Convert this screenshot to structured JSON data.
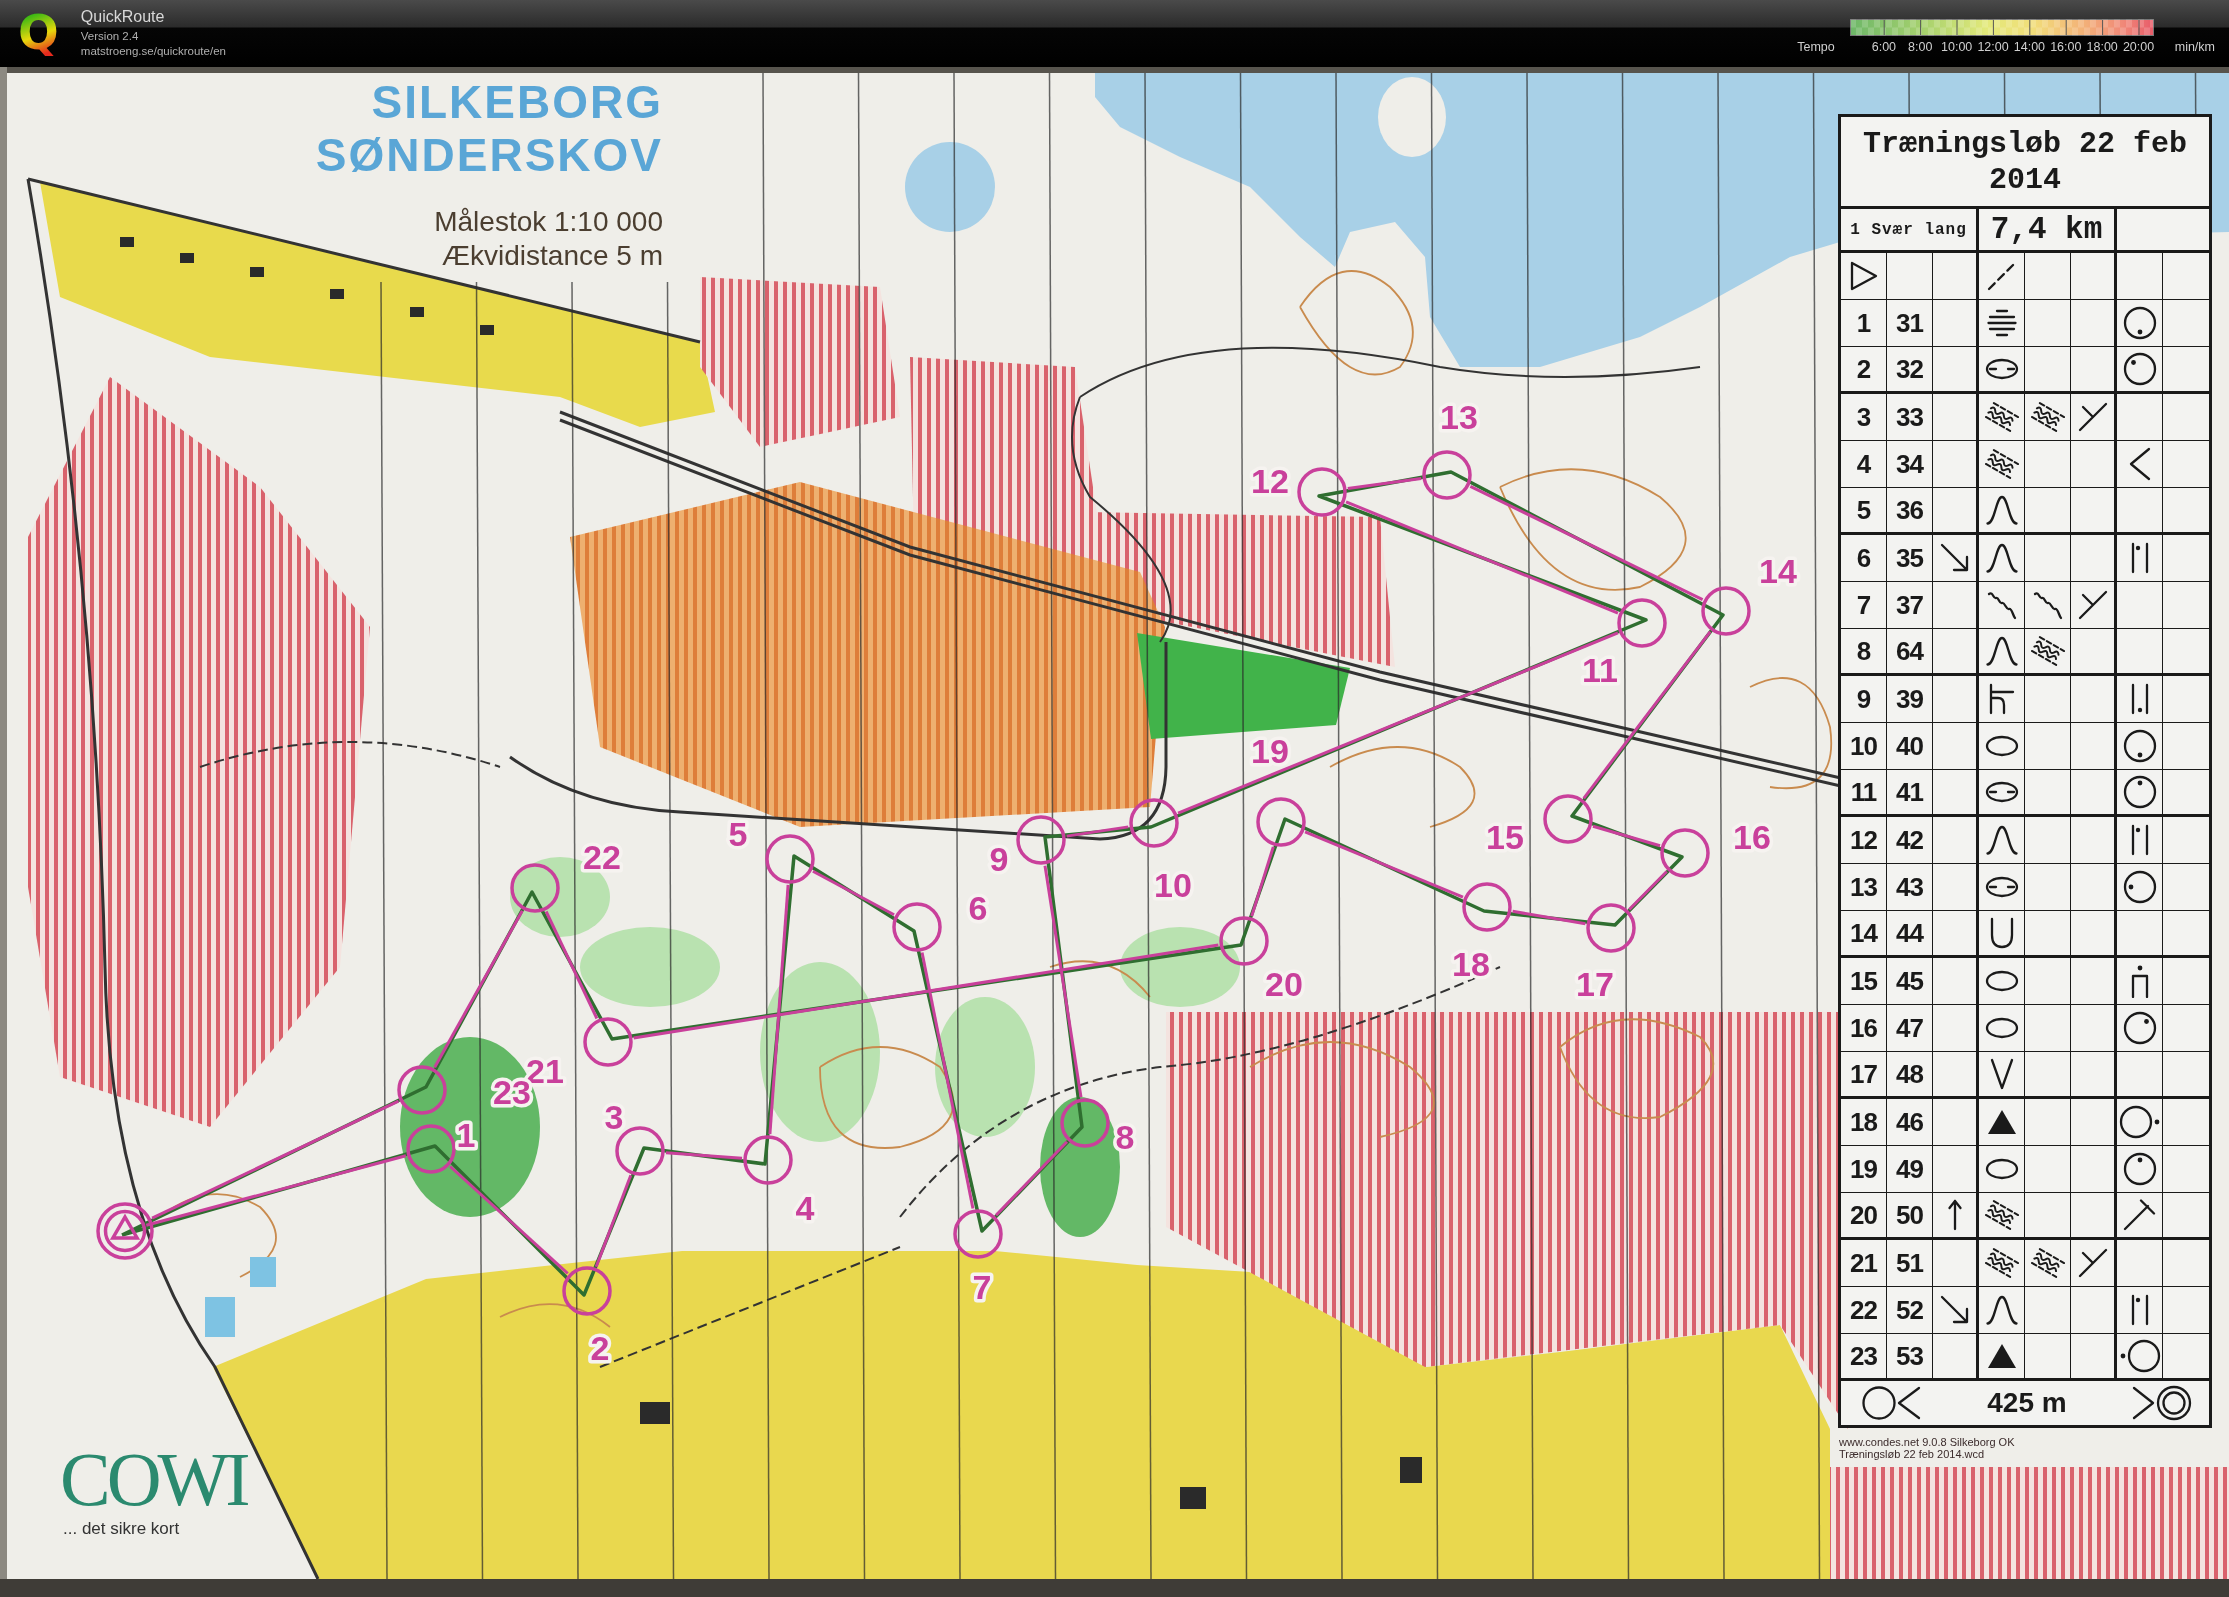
{
  "app": {
    "logo": "Q",
    "title": "QuickRoute",
    "version": "Version 2.4",
    "url": "matstroeng.se/quickroute/en"
  },
  "tempo_legend": {
    "label": "Tempo",
    "ticks": [
      "6:00",
      "8:00",
      "10:00",
      "12:00",
      "14:00",
      "16:00",
      "18:00",
      "20:00"
    ],
    "unit": "min/km"
  },
  "map": {
    "title": "SILKEBORG SØNDERSKOV",
    "scale": "Målestok 1:10 000",
    "contour_interval": "Ækvidistance 5 m",
    "controls": [
      {
        "number": "1"
      },
      {
        "number": "2"
      },
      {
        "number": "3"
      },
      {
        "number": "4"
      },
      {
        "number": "5"
      },
      {
        "number": "6"
      },
      {
        "number": "7"
      },
      {
        "number": "8"
      },
      {
        "number": "9"
      },
      {
        "number": "10"
      },
      {
        "number": "11"
      },
      {
        "number": "12"
      },
      {
        "number": "13"
      },
      {
        "number": "14"
      },
      {
        "number": "15"
      },
      {
        "number": "16"
      },
      {
        "number": "17"
      },
      {
        "number": "18"
      },
      {
        "number": "19"
      },
      {
        "number": "20"
      },
      {
        "number": "21"
      },
      {
        "number": "22"
      },
      {
        "number": "23"
      }
    ],
    "publisher": {
      "logo": "COWI",
      "slogan": "... det sikre kort"
    },
    "credits": [
      "www.condes.net 9.0.8 Silkeborg OK",
      "Træningsløb 22 feb 2014.wcd"
    ]
  },
  "control_descriptions": {
    "title": "Træningsløb 22 feb 2014",
    "course": "1 Svær lang",
    "length": "7,4 km",
    "start": {
      "feature": {
        "kind": "path"
      }
    },
    "rows": [
      {
        "number": "1",
        "code": "31",
        "feature": {
          "kind": "lines"
        },
        "location": {
          "kind": "sidesouth"
        }
      },
      {
        "number": "2",
        "code": "32",
        "feature": {
          "kind": "splitoval"
        },
        "location": {
          "kind": "sidenorthwest"
        }
      },
      {
        "number": "3",
        "code": "33",
        "feature": {
          "kind": "marsh"
        },
        "appearance": {
          "kind": "marsh"
        },
        "combination": {
          "kind": "fork"
        }
      },
      {
        "number": "4",
        "code": "34",
        "feature": {
          "kind": "marsh"
        },
        "location": {
          "kind": "angle"
        }
      },
      {
        "number": "5",
        "code": "36",
        "feature": {
          "kind": "knoll"
        }
      },
      {
        "number": "6",
        "code": "35",
        "which": {
          "kind": "southeast"
        },
        "feature": {
          "kind": "knoll"
        },
        "location": {
          "kind": "barstop"
        }
      },
      {
        "number": "7",
        "code": "37",
        "feature": {
          "kind": "squiggle"
        },
        "appearance": {
          "kind": "squiggle"
        },
        "combination": {
          "kind": "fork"
        }
      },
      {
        "number": "8",
        "code": "64",
        "feature": {
          "kind": "knoll"
        },
        "appearance": {
          "kind": "marsh"
        }
      },
      {
        "number": "9",
        "code": "39",
        "feature": {
          "kind": "tee"
        },
        "location": {
          "kind": "barsbottom"
        }
      },
      {
        "number": "10",
        "code": "40",
        "feature": {
          "kind": "oval"
        },
        "location": {
          "kind": "sidesouth"
        }
      },
      {
        "number": "11",
        "code": "41",
        "feature": {
          "kind": "splitoval"
        },
        "location": {
          "kind": "sidenorth"
        }
      },
      {
        "number": "12",
        "code": "42",
        "feature": {
          "kind": "knoll"
        },
        "location": {
          "kind": "barstop"
        }
      },
      {
        "number": "13",
        "code": "43",
        "feature": {
          "kind": "splitoval"
        },
        "location": {
          "kind": "sidewest"
        }
      },
      {
        "number": "14",
        "code": "44",
        "feature": {
          "kind": "cup"
        }
      },
      {
        "number": "15",
        "code": "45",
        "feature": {
          "kind": "oval"
        },
        "location": {
          "kind": "top"
        }
      },
      {
        "number": "16",
        "code": "47",
        "feature": {
          "kind": "oval"
        },
        "location": {
          "kind": "sidenortheast"
        }
      },
      {
        "number": "17",
        "code": "48",
        "feature": {
          "kind": "vee"
        }
      },
      {
        "number": "18",
        "code": "46",
        "feature": {
          "kind": "boulder"
        },
        "location": {
          "kind": "footeast"
        }
      },
      {
        "number": "19",
        "code": "49",
        "feature": {
          "kind": "oval"
        },
        "location": {
          "kind": "sidenorth"
        }
      },
      {
        "number": "20",
        "code": "50",
        "which": {
          "kind": "north"
        },
        "feature": {
          "kind": "marsh"
        },
        "location": {
          "kind": "slashtee"
        }
      },
      {
        "number": "21",
        "code": "51",
        "feature": {
          "kind": "marsh"
        },
        "appearance": {
          "kind": "marsh"
        },
        "combination": {
          "kind": "fork"
        }
      },
      {
        "number": "22",
        "code": "52",
        "which": {
          "kind": "southeast"
        },
        "feature": {
          "kind": "knoll"
        },
        "location": {
          "kind": "barstop"
        }
      },
      {
        "number": "23",
        "code": "53",
        "feature": {
          "kind": "boulder"
        },
        "location": {
          "kind": "footwest"
        }
      }
    ],
    "finish": {
      "distance": "425 m"
    }
  }
}
